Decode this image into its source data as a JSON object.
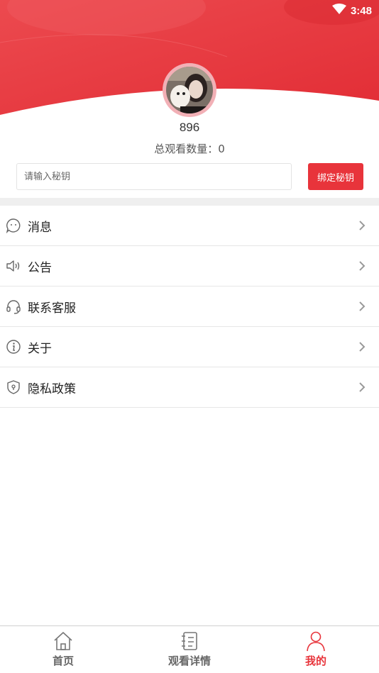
{
  "status_bar": {
    "time": "3:48",
    "icon": "wifi-icon"
  },
  "profile": {
    "username": "896",
    "views_label": "总观看数量：",
    "views_value": "0"
  },
  "secret_key": {
    "placeholder": "请输入秘钥",
    "value": "",
    "bind_label": "绑定秘钥"
  },
  "menu": {
    "items": [
      {
        "label": "消息",
        "icon": "message-icon"
      },
      {
        "label": "公告",
        "icon": "speaker-icon"
      },
      {
        "label": "联系客服",
        "icon": "headset-icon"
      },
      {
        "label": "关于",
        "icon": "info-icon"
      },
      {
        "label": "隐私政策",
        "icon": "shield-icon"
      }
    ]
  },
  "tabbar": {
    "tabs": [
      {
        "label": "首页",
        "icon": "home-icon",
        "active": false
      },
      {
        "label": "观看详情",
        "icon": "notebook-icon",
        "active": false
      },
      {
        "label": "我的",
        "icon": "person-icon",
        "active": true
      }
    ]
  },
  "colors": {
    "accent": "#e8343b",
    "header": "#e83a40"
  }
}
